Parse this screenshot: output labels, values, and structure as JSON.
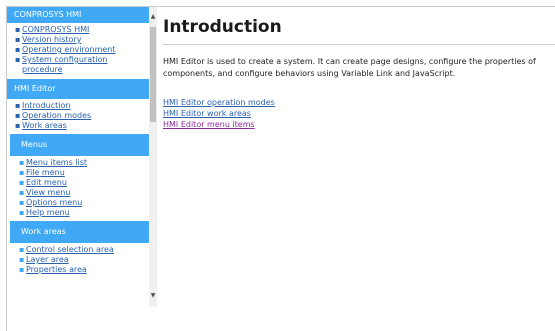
{
  "sidebar": {
    "sections": {
      "conprosys": {
        "title": "CONPROSYS HMI",
        "items": [
          {
            "label": "CONPROSYS HMI"
          },
          {
            "label": "Version history"
          },
          {
            "label": "Operating environment"
          },
          {
            "label": "System configuration procedure"
          }
        ]
      },
      "hmi_editor": {
        "title": "HMI Editor",
        "items": [
          {
            "label": "Introduction"
          },
          {
            "label": "Operation modes"
          },
          {
            "label": "Work areas"
          }
        ]
      },
      "menus": {
        "title": "Menus",
        "items": [
          {
            "label": "Menu items list"
          },
          {
            "label": "File menu"
          },
          {
            "label": "Edit menu"
          },
          {
            "label": "View menu"
          },
          {
            "label": "Options menu"
          },
          {
            "label": "Help menu"
          }
        ]
      },
      "work_areas": {
        "title": "Work areas",
        "items": [
          {
            "label": "Control selection area"
          },
          {
            "label": "Layer area"
          },
          {
            "label": "Properties area"
          }
        ]
      }
    }
  },
  "main": {
    "title": "Introduction",
    "description": "HMI Editor is used to create a system. It can create page designs, configure the properties of components, and configure behaviors using Variable Link and JavaScript.",
    "links": [
      {
        "label": "HMI Editor operation modes"
      },
      {
        "label": "HMI Editor work areas"
      },
      {
        "label": "HMI Editor menu items"
      }
    ]
  },
  "colors": {
    "section_header": "#3fa9f5",
    "link": "#2a62b0",
    "visited_link": "#8a2c9c"
  }
}
